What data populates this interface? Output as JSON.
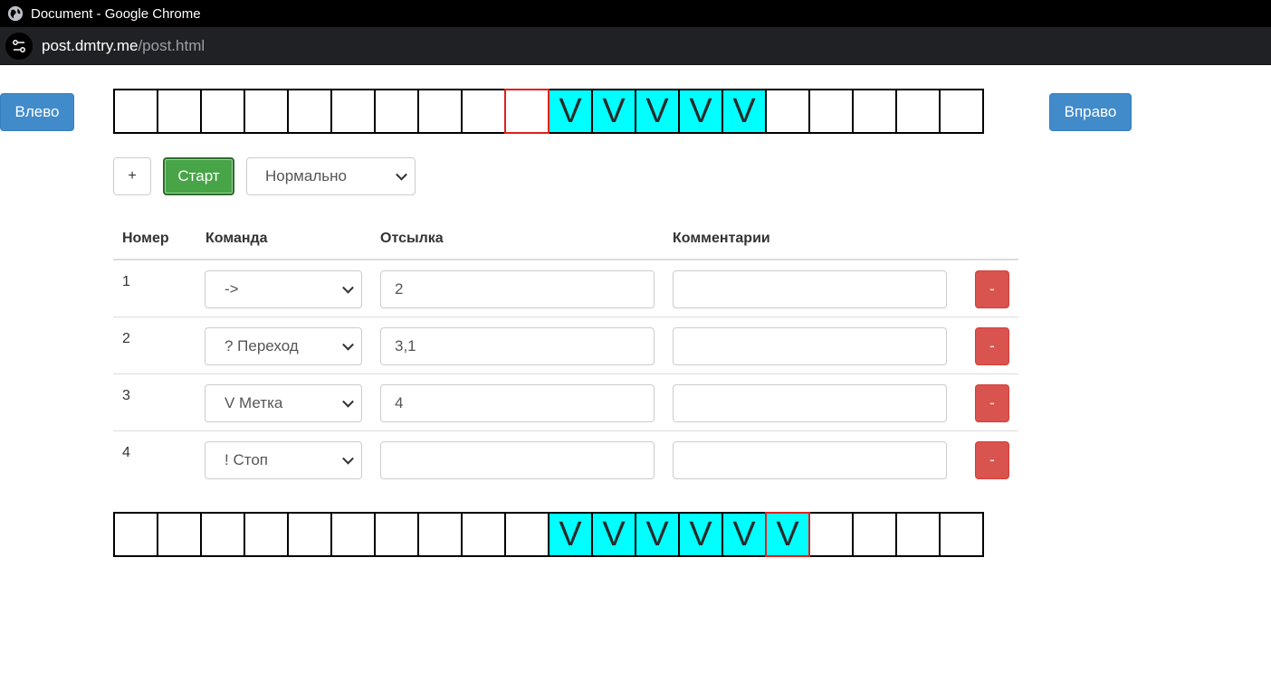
{
  "window": {
    "title": "Document - Google Chrome"
  },
  "address": {
    "host": "post.dmtry.me",
    "path": "/post.html"
  },
  "nav": {
    "left_label": "Влево",
    "right_label": "Вправо"
  },
  "top_tape": {
    "cells": [
      "",
      "",
      "",
      "",
      "",
      "",
      "",
      "",
      "",
      "",
      "V",
      "V",
      "V",
      "V",
      "V",
      "",
      "",
      "",
      "",
      ""
    ],
    "head_index": 9
  },
  "controls": {
    "add_label": "+",
    "start_label": "Старт",
    "speed_value": "Нормально"
  },
  "table": {
    "headers": {
      "number": "Номер",
      "command": "Команда",
      "reference": "Отсылка",
      "comment": "Комментарии"
    },
    "rows": [
      {
        "number": "1",
        "command": "->",
        "reference": "2",
        "comment": "",
        "delete_label": "-"
      },
      {
        "number": "2",
        "command": "? Переход",
        "reference": "3,1",
        "comment": "",
        "delete_label": "-"
      },
      {
        "number": "3",
        "command": "V Метка",
        "reference": "4",
        "comment": "",
        "delete_label": "-"
      },
      {
        "number": "4",
        "command": "! Стоп",
        "reference": "",
        "comment": "",
        "delete_label": "-"
      }
    ]
  },
  "bottom_tape": {
    "cells": [
      "",
      "",
      "",
      "",
      "",
      "",
      "",
      "",
      "",
      "",
      "V",
      "V",
      "V",
      "V",
      "V",
      "V",
      "",
      "",
      "",
      ""
    ],
    "head_index": 15
  },
  "colors": {
    "marked_cell": "#00ffff",
    "head_border": "#e0201a",
    "primary": "#428bca",
    "success": "#47a447",
    "danger": "#d9534f"
  }
}
